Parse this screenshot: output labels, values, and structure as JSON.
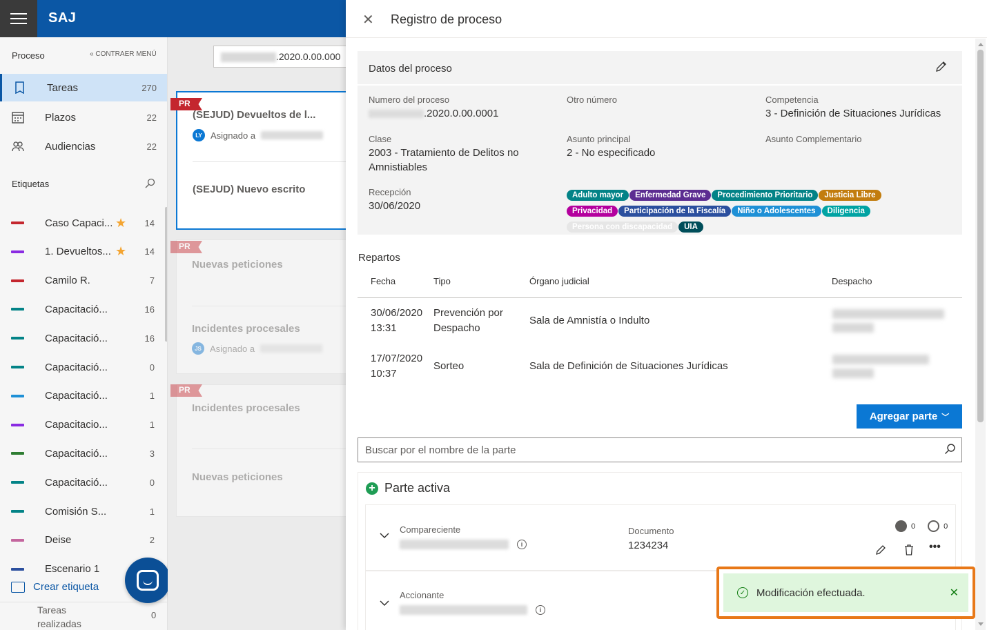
{
  "app": {
    "brand": "SAJ"
  },
  "sidebar": {
    "section_label": "Proceso",
    "collapse_label": "CONTRAER MENÚ",
    "nav": [
      {
        "label": "Tareas",
        "count": "270",
        "icon": "book-icon"
      },
      {
        "label": "Plazos",
        "count": "22",
        "icon": "calendar-icon"
      },
      {
        "label": "Audiencias",
        "count": "22",
        "icon": "people-icon"
      }
    ],
    "tags_label": "Etiquetas",
    "tags": [
      {
        "label": "Caso Capaci...",
        "count": "14",
        "color": "#c4262e",
        "star": true
      },
      {
        "label": "1. Devueltos...",
        "count": "14",
        "color": "#8a2be2",
        "star": true
      },
      {
        "label": "Camilo R.",
        "count": "7",
        "color": "#c4262e",
        "star": false
      },
      {
        "label": "Capacitació...",
        "count": "16",
        "color": "#038387",
        "star": false
      },
      {
        "label": "Capacitació...",
        "count": "16",
        "color": "#038387",
        "star": false
      },
      {
        "label": "Capacitació...",
        "count": "0",
        "color": "#038387",
        "star": false
      },
      {
        "label": "Capacitació...",
        "count": "1",
        "color": "#1e90d6",
        "star": false
      },
      {
        "label": "Capacitacio...",
        "count": "1",
        "color": "#8a2be2",
        "star": false
      },
      {
        "label": "Capacitació...",
        "count": "3",
        "color": "#2e7d32",
        "star": false
      },
      {
        "label": "Capacitació...",
        "count": "0",
        "color": "#038387",
        "star": false
      },
      {
        "label": "Comisión S...",
        "count": "1",
        "color": "#038387",
        "star": false
      },
      {
        "label": "Deise",
        "count": "2",
        "color": "#c4669e",
        "star": false
      },
      {
        "label": "Escenario 1",
        "count": "",
        "color": "#2b4f9e",
        "star": false
      }
    ],
    "create_tag_label": "Crear etiqueta",
    "done_label": "Tareas realizadas",
    "done_count": "0"
  },
  "middle": {
    "search_value": ".2020.0.00.000",
    "cards": [
      {
        "flag": "PR",
        "items": [
          {
            "title": "(SEJUD) Devueltos de l...",
            "assign_label": "Asignado a",
            "avatar": "LY"
          },
          {
            "title": "(SEJUD) Nuevo escrito",
            "assign_label": "",
            "avatar": ""
          }
        ]
      },
      {
        "flag": "PR",
        "items": [
          {
            "title": "Nuevas peticiones",
            "assign_label": "",
            "avatar": ""
          },
          {
            "title": "Incidentes procesales",
            "assign_label": "Asignado a",
            "avatar": "JS"
          }
        ]
      },
      {
        "flag": "PR",
        "items": [
          {
            "title": "Incidentes procesales",
            "assign_label": "",
            "avatar": ""
          },
          {
            "title": "Nuevas peticiones",
            "assign_label": "",
            "avatar": ""
          }
        ]
      }
    ]
  },
  "panel": {
    "title": "Registro de proceso",
    "datos": {
      "title": "Datos del proceso",
      "numero_label": "Numero del proceso",
      "numero_value": ".2020.0.00.0001",
      "otro_label": "Otro número",
      "competencia_label": "Competencia",
      "competencia_value": "3 - Definición de Situaciones Jurídicas",
      "clase_label": "Clase",
      "clase_value": "2003 - Tratamiento de Delitos no Amnistiables",
      "asunto_label": "Asunto principal",
      "asunto_value": "2 - No especificado",
      "asunto_comp_label": "Asunto Complementario",
      "recepcion_label": "Recepción",
      "recepcion_value": "30/06/2020",
      "chips": [
        {
          "label": "Adulto mayor",
          "color": "#038387"
        },
        {
          "label": "Enfermedad Grave",
          "color": "#5c2d91"
        },
        {
          "label": "Procedimiento Prioritario",
          "color": "#038387"
        },
        {
          "label": "Justicia Libre",
          "color": "#c27c0e"
        },
        {
          "label": "Privacidad",
          "color": "#b4009e"
        },
        {
          "label": "Participación de la Fiscalía",
          "color": "#2b4f9e"
        },
        {
          "label": "Niño o Adolescentes",
          "color": "#1e90d6"
        },
        {
          "label": "Diligencia",
          "color": "#00a3a3"
        },
        {
          "label": "Persona con discapacidad",
          "color": "#e6e6e6"
        },
        {
          "label": "UIA",
          "color": "#004e5a"
        }
      ]
    },
    "repartos": {
      "title": "Repartos",
      "headers": {
        "fecha": "Fecha",
        "tipo": "Tipo",
        "organo": "Órgano judicial",
        "despacho": "Despacho"
      },
      "rows": [
        {
          "fecha": "30/06/2020",
          "hora": "13:31",
          "tipo1": "Prevención por",
          "tipo2": "Despacho",
          "organo": "Sala de Amnistía o Indulto"
        },
        {
          "fecha": "17/07/2020",
          "hora": "10:37",
          "tipo1": "Sorteo",
          "tipo2": "",
          "organo": "Sala de Definición de Situaciones Jurídicas"
        }
      ]
    },
    "agregar_label": "Agregar parte",
    "search_placeholder": "Buscar por el nombre de la parte",
    "parte": {
      "title": "Parte activa",
      "rows": [
        {
          "role": "Compareciente",
          "doc_label": "Documento",
          "doc_value": "1234234",
          "count_a": "0",
          "count_b": "0"
        },
        {
          "role": "Accionante"
        }
      ]
    },
    "toast": {
      "message": "Modificación efectuada."
    }
  }
}
